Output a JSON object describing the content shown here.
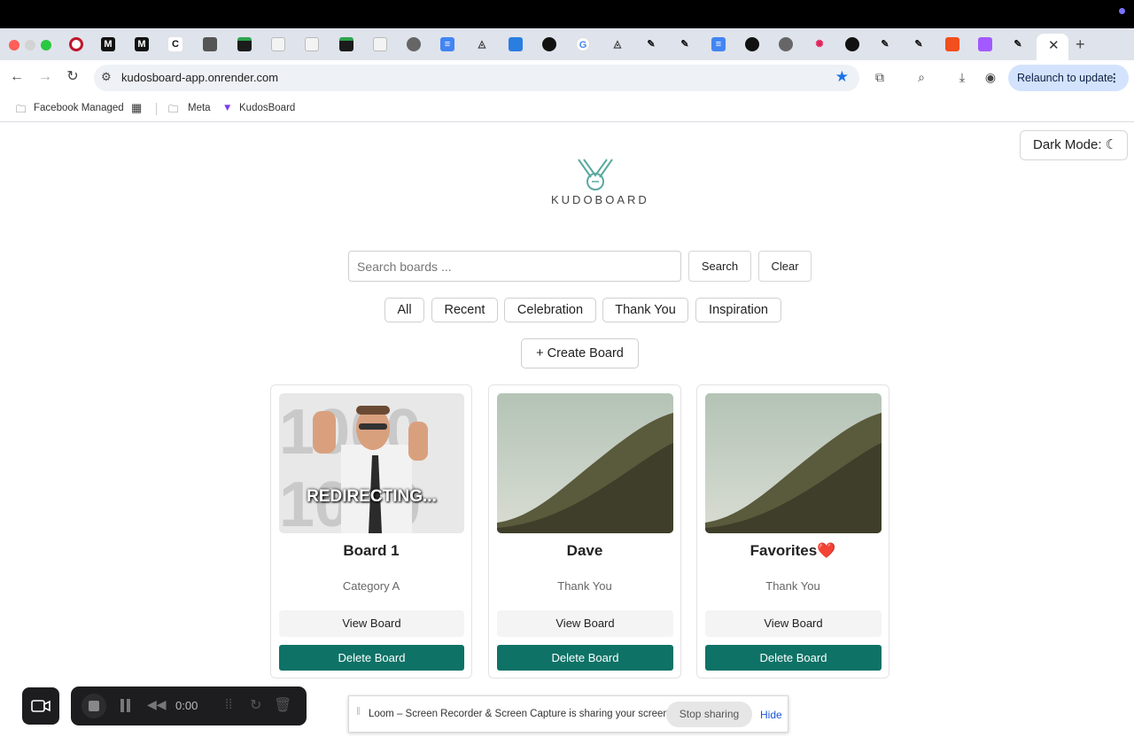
{
  "browser": {
    "url": "kudosboard-app.onrender.com",
    "relaunch_label": "Relaunch to update",
    "bookmarks": [
      "Facebook Managed",
      "Meta",
      "KudosBoard"
    ]
  },
  "page": {
    "dark_mode_label": "Dark Mode:",
    "logo_text": "KUDOBOARD",
    "search": {
      "placeholder": "Search boards ...",
      "search_label": "Search",
      "clear_label": "Clear"
    },
    "filters": [
      "All",
      "Recent",
      "Celebration",
      "Thank You",
      "Inspiration"
    ],
    "create_label": "+ Create Board",
    "boards": [
      {
        "title": "Board 1",
        "category": "Category A",
        "image": "redirecting-gif",
        "image_caption": "REDIRECTING...",
        "view_label": "View Board",
        "delete_label": "Delete Board"
      },
      {
        "title": "Dave",
        "category": "Thank You",
        "image": "hillside-landscape",
        "view_label": "View Board",
        "delete_label": "Delete Board"
      },
      {
        "title": "Favorites❤️",
        "category": "Thank You",
        "image": "hillside-landscape",
        "view_label": "View Board",
        "delete_label": "Delete Board"
      }
    ]
  },
  "loom": {
    "timer": "0:00",
    "share_text": "Loom – Screen Recorder & Screen Capture is sharing your screen.",
    "stop_label": "Stop sharing",
    "hide_label": "Hide"
  },
  "colors": {
    "accent_teal": "#0e7266",
    "relaunch_bg": "#d3e3fd",
    "star_blue": "#1a73e8"
  }
}
